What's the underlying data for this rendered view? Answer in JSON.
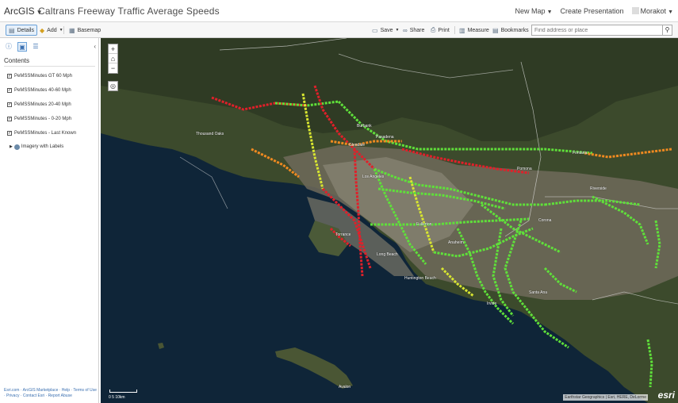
{
  "header": {
    "brand": "ArcGIS",
    "title": "Caltrans Freeway Traffic Average Speeds",
    "new_map": "New Map",
    "create_presentation": "Create Presentation",
    "user": "Morakot"
  },
  "toolbar": {
    "details": "Details",
    "add": "Add",
    "basemap": "Basemap",
    "save": "Save",
    "share": "Share",
    "print": "Print",
    "measure": "Measure",
    "bookmarks": "Bookmarks",
    "search_placeholder": "Find address or place"
  },
  "sidebar": {
    "contents_title": "Contents",
    "layers": [
      {
        "label": "PeMSSMinutes GT 60 Mph",
        "checked": true
      },
      {
        "label": "PeMSSMinutes 40-60 Mph",
        "checked": true
      },
      {
        "label": "PeMSSMinutes 20-40 Mph",
        "checked": true
      },
      {
        "label": "PeMSSMinutes - 0-20 Mph",
        "checked": true
      },
      {
        "label": "PeMSSMinutes - Last Known",
        "checked": true
      }
    ],
    "basemap_layer": "Imagery with Labels",
    "footer": "Esri.com · ArcGIS Marketplace · Help · Terms of Use · Privacy · Contact Esri · Report Abuse"
  },
  "map": {
    "scale_label": "0    5    10km",
    "attribution": "Earthstar Geographics | Esri, HERE, DeLorme",
    "logo": "esri",
    "places": [
      {
        "name": "Los Angeles"
      },
      {
        "name": "Burbank"
      },
      {
        "name": "Glendale"
      },
      {
        "name": "Pasadena"
      },
      {
        "name": "Pomona"
      },
      {
        "name": "Fontana"
      },
      {
        "name": "Riverside"
      },
      {
        "name": "Corona"
      },
      {
        "name": "Anaheim"
      },
      {
        "name": "Fullerton"
      },
      {
        "name": "Long Beach"
      },
      {
        "name": "Torrance"
      },
      {
        "name": "Irvine"
      },
      {
        "name": "Thousand Oaks"
      },
      {
        "name": "Santa Ana"
      },
      {
        "name": "Huntington Beach"
      },
      {
        "name": "Avalon"
      }
    ]
  },
  "colors": {
    "fast": "#5fe03a",
    "medium": "#d8e630",
    "slow": "#f08a20",
    "stopped": "#e0202a",
    "accent": "#3a6fb0"
  }
}
